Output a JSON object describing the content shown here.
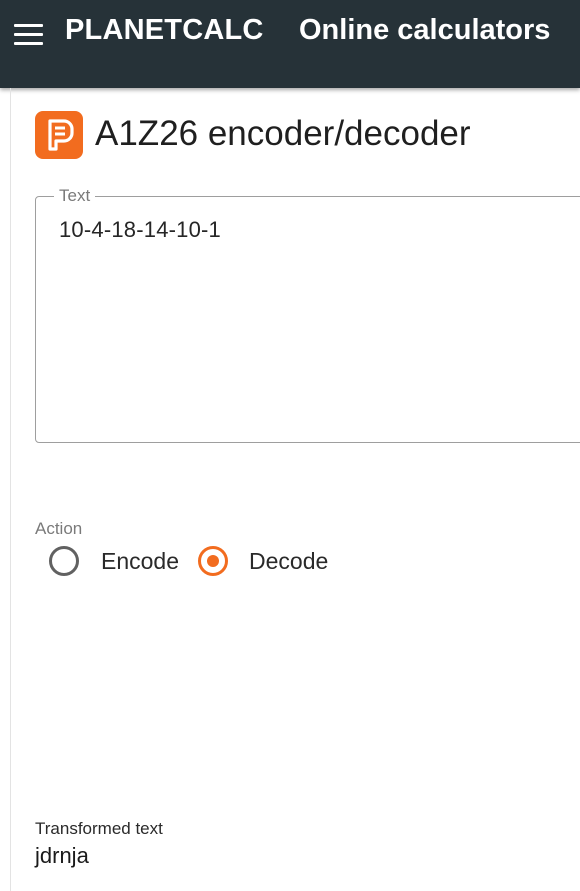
{
  "header": {
    "brand": "PLANETCALC",
    "title": "Online calculators"
  },
  "page": {
    "title": "A1Z26 encoder/decoder",
    "logo_icon": "planetcalc-logo-icon"
  },
  "form": {
    "text_label": "Text",
    "text_value": "10-4-18-14-10-1",
    "action_label": "Action",
    "actions": [
      {
        "label": "Encode",
        "selected": false
      },
      {
        "label": "Decode",
        "selected": true
      }
    ]
  },
  "result": {
    "label": "Transformed text",
    "value": "jdrnja"
  },
  "colors": {
    "appbar": "#263238",
    "accent": "#f26c1f"
  }
}
